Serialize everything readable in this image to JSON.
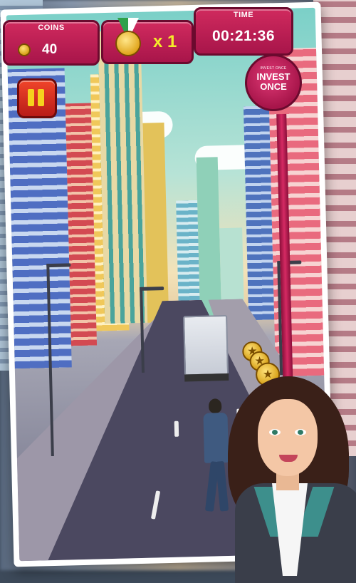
{
  "hud": {
    "coins_label": "COINS",
    "coins_value": "40",
    "multiplier": "x 1",
    "time_label": "TIME",
    "time_value": "00:21:36"
  },
  "billboard": {
    "small_text": "INVEST ONCE",
    "big_text": "INVEST ONCE"
  },
  "icons": {
    "pause": "pause-icon",
    "medal": "medal-icon",
    "coin": "coin-icon"
  },
  "colors": {
    "hud_panel": "#c61f55",
    "pause_button": "#e23a22",
    "text_yellow": "#f5ec2a"
  }
}
